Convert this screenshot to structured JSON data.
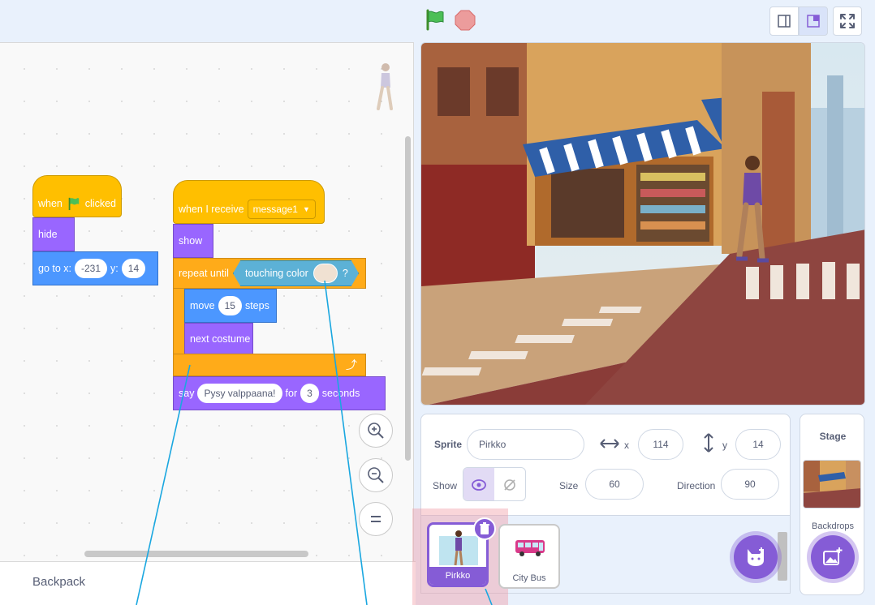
{
  "code": {
    "script1": {
      "hat_when": "when",
      "hat_clicked": "clicked",
      "hide": "hide",
      "goto_label": "go to x:",
      "goto_x": "-231",
      "goto_y_label": "y:",
      "goto_y": "14"
    },
    "script2": {
      "when_receive": "when I receive",
      "message": "message1",
      "show": "show",
      "repeat_until": "repeat until",
      "touching_color": "touching color",
      "question": "?",
      "touch_color": "#f0e1d2",
      "move": "move",
      "move_steps_value": "15",
      "steps": "steps",
      "next_costume": "next costume",
      "say": "say",
      "say_text": "Pysy valppaana!",
      "for": "for",
      "seconds_value": "3",
      "seconds": "seconds"
    },
    "zoom_icons": [
      "zoom-in-icon",
      "zoom-out-icon",
      "zoom-reset-icon"
    ]
  },
  "backpack": {
    "label": "Backpack"
  },
  "sprite_info": {
    "sprite_label": "Sprite",
    "sprite_name": "Pirkko",
    "x_label": "x",
    "x_value": "114",
    "y_label": "y",
    "y_value": "14",
    "show_label": "Show",
    "size_label": "Size",
    "size_value": "60",
    "direction_label": "Direction",
    "direction_value": "90"
  },
  "sprites": [
    {
      "name": "Pirkko",
      "selected": true
    },
    {
      "name": "City Bus",
      "selected": false
    }
  ],
  "stage_pane": {
    "title": "Stage",
    "backdrops_label": "Backdrops"
  },
  "colors": {
    "accent": "#855cd6",
    "events": "#ffbf00",
    "looks": "#9966ff",
    "motion": "#4c97ff",
    "control": "#ffab19",
    "sensing": "#5cb1d6"
  }
}
